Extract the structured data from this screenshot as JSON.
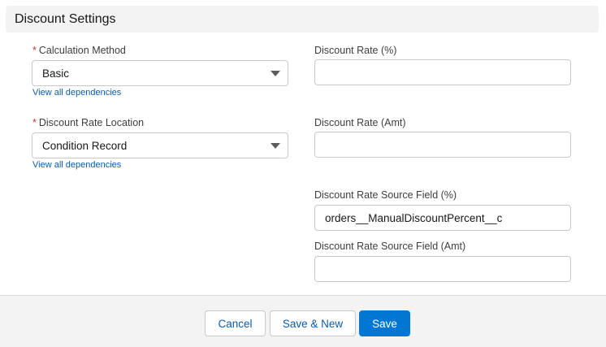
{
  "section": {
    "title": "Discount Settings"
  },
  "left": {
    "calc_method": {
      "label": "Calculation Method",
      "required": "*",
      "value": "Basic",
      "link": "View all dependencies"
    },
    "rate_location": {
      "label": "Discount Rate Location",
      "required": "*",
      "value": "Condition Record",
      "link": "View all dependencies"
    }
  },
  "right": {
    "rate_pct": {
      "label": "Discount Rate (%)",
      "value": ""
    },
    "rate_amt": {
      "label": "Discount Rate (Amt)",
      "value": ""
    },
    "source_pct": {
      "label": "Discount Rate Source Field (%)",
      "value": "orders__ManualDiscountPercent__c"
    },
    "source_amt": {
      "label": "Discount Rate Source Field (Amt)",
      "value": ""
    }
  },
  "footer": {
    "cancel": "Cancel",
    "save_new": "Save & New",
    "save": "Save"
  },
  "colors": {
    "brand": "#0176d3",
    "link": "#0b5cab",
    "required": "#c23934"
  },
  "icons": {
    "select_caret": "chevron-down-icon"
  }
}
